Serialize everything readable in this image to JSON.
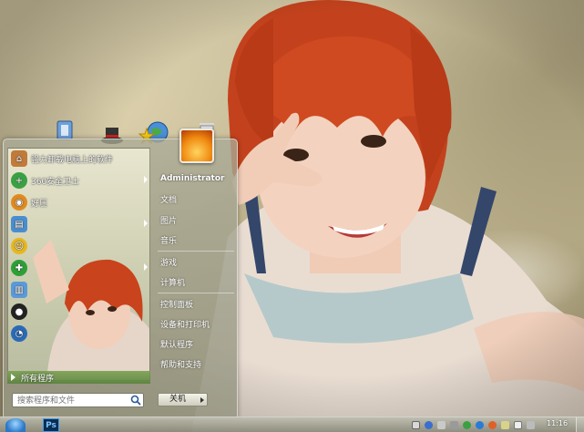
{
  "desktop": {
    "icons": [
      "recycle-bin-icon",
      "magic-hat-icon",
      "globe-icon",
      "star-icon",
      "trash-can-icon"
    ]
  },
  "start_menu": {
    "programs": [
      {
        "label": "强力卸载电脑上的软件",
        "icon": "uninstaller-icon",
        "color": "#c07a3a",
        "arrow": false
      },
      {
        "label": "360安全卫士",
        "icon": "360-safe-icon",
        "color": "#3aa043",
        "arrow": true
      },
      {
        "label": "好压",
        "icon": "compress-icon",
        "color": "#e08a20",
        "arrow": false
      },
      {
        "label": "",
        "icon": "book-icon",
        "color": "#4a8ed0",
        "arrow": true
      },
      {
        "label": "",
        "icon": "chat-icon",
        "color": "#e6b820",
        "arrow": false
      },
      {
        "label": "",
        "icon": "browser-icon",
        "color": "#2f9f38",
        "arrow": true
      },
      {
        "label": "",
        "icon": "file-icon",
        "color": "#5b9ad8",
        "arrow": false
      },
      {
        "label": "",
        "icon": "qq-penguin-icon",
        "color": "#222222",
        "arrow": false
      },
      {
        "label": "",
        "icon": "speedometer-icon",
        "color": "#2a6ab8",
        "arrow": false
      }
    ],
    "all_programs_label": "所有程序",
    "search_placeholder": "搜索程序和文件",
    "right_items": {
      "user": "Administrator",
      "documents": "文档",
      "pictures": "图片",
      "music": "音乐",
      "games": "游戏",
      "computer": "计算机",
      "control_panel": "控制面板",
      "devices_printers": "设备和打印机",
      "default_programs": "默认程序",
      "help_support": "帮助和支持"
    },
    "shutdown_label": "关机"
  },
  "taskbar": {
    "pinned": [
      {
        "label": "Ps",
        "icon": "photoshop-icon"
      }
    ],
    "tray_icons": [
      "keyboard-icon",
      "help-icon",
      "arrow-icon",
      "volume-icon",
      "security-icon",
      "network-icon",
      "notification-icon",
      "battery-icon",
      "speaker-icon"
    ],
    "clock": "11:16"
  }
}
